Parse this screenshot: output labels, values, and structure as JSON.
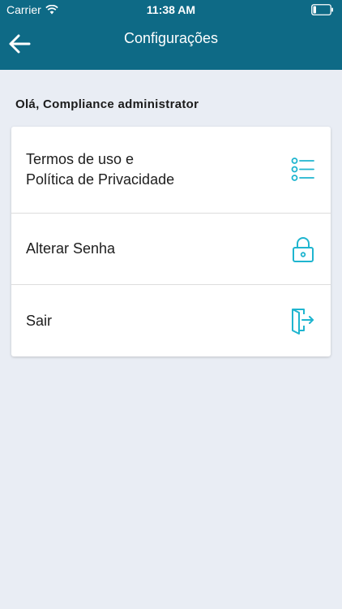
{
  "status_bar": {
    "carrier": "Carrier",
    "time": "11:38 AM"
  },
  "nav": {
    "title": "Configurações"
  },
  "greeting": "Olá, Compliance administrator",
  "menu": {
    "items": [
      {
        "line1": "Termos de uso  e",
        "line2": "Política de Privacidade",
        "icon": "list-icon"
      },
      {
        "label": "Alterar Senha",
        "icon": "lock-icon"
      },
      {
        "label": "Sair",
        "icon": "exit-door-icon"
      }
    ]
  },
  "colors": {
    "header": "#0e6a86",
    "accent": "#1fb5cf",
    "background": "#e9edf4"
  }
}
